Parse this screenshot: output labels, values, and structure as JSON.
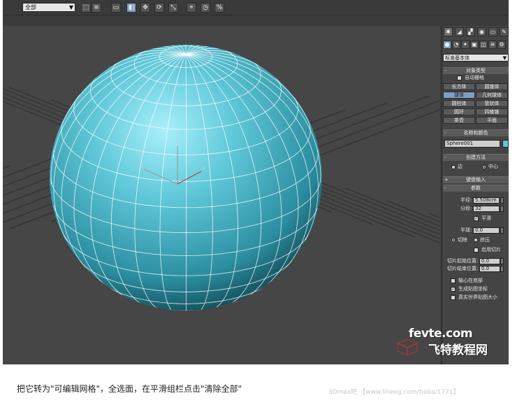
{
  "toolbar": {
    "selection_filter": "全部",
    "buttons": [
      "select-icon",
      "select-name-icon",
      "rect-region-icon",
      "window-icon",
      "move-icon",
      "rotate-icon",
      "scale-icon",
      "ref-coord-icon",
      "pivot-icon",
      "mirror-icon",
      "align-icon",
      "snap-icon",
      "angle-snap-icon",
      "percent-snap-icon",
      "spinner-snap-icon"
    ]
  },
  "viewport": {
    "object_color": "#5ec7d8",
    "axes": {
      "x": "x",
      "y": "y",
      "z": "z"
    }
  },
  "panel": {
    "category": "标准基本体",
    "object_type": {
      "title": "对象类型",
      "autogrid": "自动栅格",
      "buttons": [
        {
          "label": "长方体",
          "active": false
        },
        {
          "label": "圆锥体",
          "active": false
        },
        {
          "label": "球体",
          "active": true
        },
        {
          "label": "几何球体",
          "active": false
        },
        {
          "label": "圆柱体",
          "active": false
        },
        {
          "label": "管状体",
          "active": false
        },
        {
          "label": "圆环",
          "active": false
        },
        {
          "label": "四棱锥",
          "active": false
        },
        {
          "label": "茶壶",
          "active": false
        },
        {
          "label": "平面",
          "active": false
        }
      ]
    },
    "name_color": {
      "title": "名称和颜色",
      "name": "Sphere001",
      "color": "#5ec7d8"
    },
    "creation_method": {
      "title": "创建方法",
      "edge": "边",
      "center": "中心"
    },
    "keyboard_entry": {
      "title": "键盘输入"
    },
    "parameters": {
      "title": "参数",
      "radius_label": "半径:",
      "radius_value": "5.508cm",
      "segments_label": "分段:",
      "segments_value": "32",
      "smooth_label": "平滑",
      "hemisphere_label": "半球:",
      "hemisphere_value": "0.0",
      "chop_label": "切除",
      "squash_label": "挤压",
      "enable_slice_label": "启用切片",
      "slice_from_label": "切片起始位置:",
      "slice_from_value": "0.0",
      "slice_to_label": "切片结束位置:",
      "slice_to_value": "0.0",
      "base_pivot_label": "轴心在底部",
      "gen_map_label": "生成贴图坐标",
      "real_world_label": "真实世界贴图大小"
    }
  },
  "watermark": {
    "url": "fevte.com",
    "name": "飞特教程网"
  },
  "caption": "把它转为\"可编辑网格\"，全选面，在平滑组栏点击\"清除全部\"",
  "source": "3Dmax吧 【www.lineeg.com/tieba/1771】"
}
